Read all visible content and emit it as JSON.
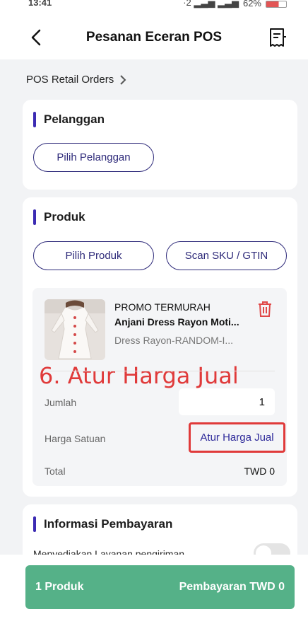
{
  "status_bar": {
    "time": "13:41",
    "signal": "·2 ▂▃▅ ▂▃▅",
    "battery_pct": "62%"
  },
  "header": {
    "title": "Pesanan Eceran POS"
  },
  "breadcrumb": {
    "label": "POS Retail Orders"
  },
  "customer_section": {
    "title": "Pelanggan",
    "pick_button": "Pilih Pelanggan"
  },
  "product_section": {
    "title": "Produk",
    "pick_button": "Pilih Produk",
    "scan_button": "Scan SKU / GTIN",
    "item": {
      "promo": "PROMO TERMURAH",
      "name": "Anjani Dress Rayon Moti...",
      "variant": "Dress Rayon-RANDOM-I...",
      "quantity_label": "Jumlah",
      "quantity": "1",
      "unit_price_label": "Harga Satuan",
      "set_price_button": "Atur Harga Jual",
      "total_label": "Total",
      "total_value": "TWD 0"
    },
    "annotation": "6. Atur Harga Jual"
  },
  "payment_section": {
    "title": "Informasi Pembayaran",
    "shipping_label": "Menyediakan Layanan pengiriman"
  },
  "bottom_bar": {
    "count_label": "1 Produk",
    "pay_label": "Pembayaran TWD 0"
  },
  "colors": {
    "accent": "#3c2bb3",
    "primary_green": "#55b188",
    "annotation_red": "#e03a3a"
  }
}
